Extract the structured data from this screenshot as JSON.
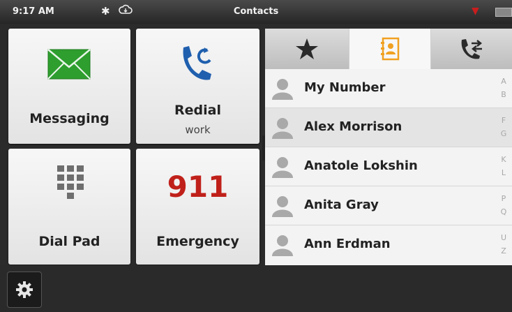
{
  "status_bar": {
    "time": "9:17 AM",
    "title": "Contacts",
    "bluetooth_icon": "bluetooth-icon",
    "cloud_icon": "cloud-icon",
    "signal_icon": "signal-icon",
    "battery_icon": "battery-icon"
  },
  "tiles": {
    "messaging": {
      "label": "Messaging",
      "icon": "envelope-icon"
    },
    "redial": {
      "label": "Redial",
      "sublabel": "work",
      "icon": "phone-redial-icon"
    },
    "dialpad": {
      "label": "Dial Pad",
      "icon": "keypad-icon"
    },
    "emergency": {
      "label": "Emergency",
      "number": "911"
    }
  },
  "tabs": [
    {
      "name": "favorites",
      "icon": "star-icon"
    },
    {
      "name": "contacts",
      "icon": "contact-card-icon",
      "active": true
    },
    {
      "name": "recent",
      "icon": "call-log-icon"
    }
  ],
  "contacts": [
    {
      "name": "My Number",
      "index": [
        "A",
        "B"
      ]
    },
    {
      "name": "Alex  Morrison",
      "index": [
        "F",
        "G"
      ]
    },
    {
      "name": "Anatole  Lokshin",
      "index": [
        "K",
        "L"
      ]
    },
    {
      "name": "Anita  Gray",
      "index": [
        "P",
        "Q"
      ]
    },
    {
      "name": "Ann  Erdman",
      "index": [
        "U",
        "Z"
      ]
    }
  ],
  "bottom_bar": {
    "settings_icon": "gear-icon"
  },
  "colors": {
    "accent_orange": "#f0a020",
    "emergency_red": "#c0201a",
    "message_green": "#2e9e2e",
    "phone_blue": "#1f5fae"
  }
}
